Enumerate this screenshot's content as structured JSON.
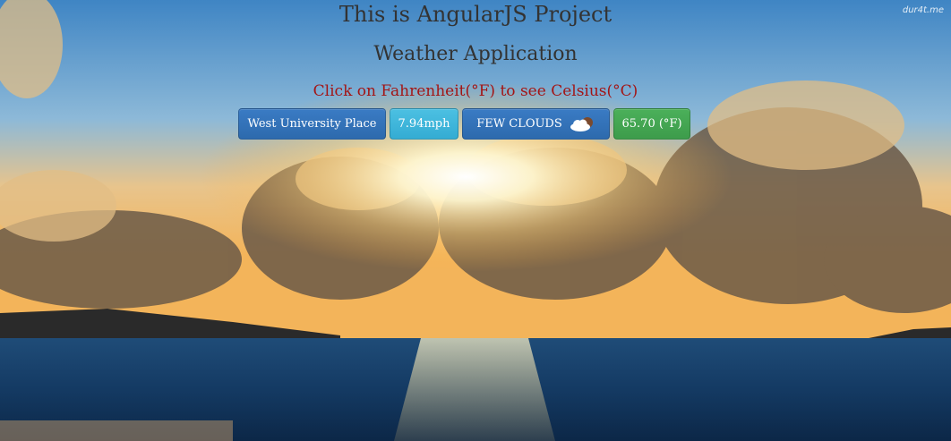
{
  "watermark": "dur4t.me",
  "header": {
    "title": "This is AngularJS Project",
    "subtitle": "Weather Application",
    "hint": "Click on Fahrenheit(°F) to see Celsius(°C)"
  },
  "weather": {
    "city": "West University Place",
    "wind": "7.94mph",
    "condition": "FEW CLOUDS",
    "condition_icon": "partly-cloudy-icon",
    "temperature": "65.70 (°F)"
  },
  "colors": {
    "title_text": "#333333",
    "hint_text": "#a31515",
    "primary_button": "#2d6aad",
    "info_button": "#34acd3",
    "success_button": "#3d9c4b"
  }
}
